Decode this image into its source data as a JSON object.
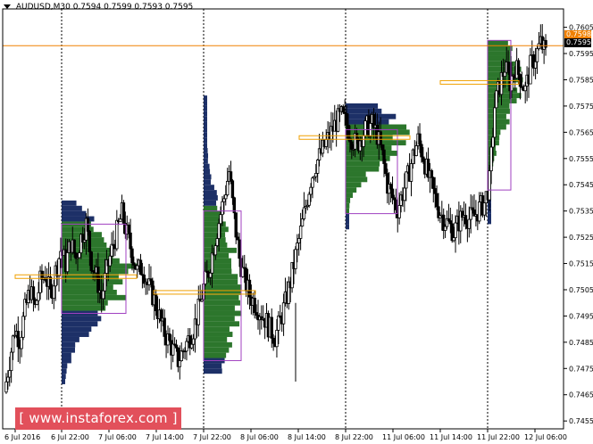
{
  "symbol": {
    "title": "AUDUSD,M30  0.7594 0.7599 0.7593 0.7595"
  },
  "price_tags": {
    "ask": "0.7598",
    "bid": "0.7595"
  },
  "watermark": "[ www.instaforex.com ]",
  "colors": {
    "background": "#ffffff",
    "candle": "#000000",
    "profile_green": "#1a6a1a",
    "profile_navy": "#0a1e5a",
    "value_area_box": "#a040c0",
    "poc_line": "#f0a000",
    "ask_line": "#f08000",
    "bid_tag": "#000000"
  },
  "chart_data": {
    "type": "candlestick",
    "ylim": [
      0.7452,
      0.7612
    ],
    "y_ticks": [
      "0.7605",
      "0.7595",
      "0.7585",
      "0.7575",
      "0.7565",
      "0.7555",
      "0.7545",
      "0.7535",
      "0.7525",
      "0.7515",
      "0.7505",
      "0.7495",
      "0.7485",
      "0.7475",
      "0.7465",
      "0.7455"
    ],
    "x_ticks": [
      "6 Jul 2016",
      "6 Jul 22:00",
      "7 Jul 06:00",
      "7 Jul 14:00",
      "7 Jul 22:00",
      "8 Jul 06:00",
      "8 Jul 14:00",
      "8 Jul 22:00",
      "11 Jul 06:00",
      "11 Jul 14:00",
      "11 Jul 22:00",
      "12 Jul 06:00"
    ],
    "session_separators": [
      "6 Jul 22:00",
      "7 Jul 22:00",
      "8 Jul 22:00",
      "11 Jul 22:00"
    ],
    "ask_level": 0.7598,
    "close_path": [
      0.7466,
      0.7478,
      0.749,
      0.7486,
      0.7497,
      0.7505,
      0.7498,
      0.7508,
      0.7511,
      0.7503,
      0.7512,
      0.752,
      0.7515,
      0.7523,
      0.7517,
      0.7525,
      0.753,
      0.7516,
      0.751,
      0.7502,
      0.7512,
      0.752,
      0.7527,
      0.7534,
      0.7526,
      0.7519,
      0.7512,
      0.7514,
      0.7507,
      0.7503,
      0.7497,
      0.749,
      0.7486,
      0.7482,
      0.7478,
      0.7482,
      0.7486,
      0.749,
      0.7497,
      0.7506,
      0.7512,
      0.7522,
      0.7531,
      0.754,
      0.755,
      0.7532,
      0.7517,
      0.7509,
      0.7503,
      0.75,
      0.7497,
      0.7494,
      0.749,
      0.7487,
      0.7493,
      0.75,
      0.7508,
      0.7518,
      0.7527,
      0.7537,
      0.7547,
      0.7553,
      0.7557,
      0.7561,
      0.7565,
      0.7569,
      0.7571,
      0.7568,
      0.7563,
      0.756,
      0.7564,
      0.7567,
      0.7568,
      0.7564,
      0.7556,
      0.7545,
      0.754,
      0.7536,
      0.7542,
      0.7548,
      0.7556,
      0.7562,
      0.7556,
      0.7548,
      0.7542,
      0.7536,
      0.7532,
      0.753,
      0.7527,
      0.7531,
      0.7534,
      0.7532,
      0.7533,
      0.7536,
      0.7538,
      0.7546,
      0.7575,
      0.7583,
      0.759,
      0.7584,
      0.759,
      0.7586,
      0.7581,
      0.759,
      0.7594,
      0.7599,
      0.7595
    ],
    "sessions": [
      {
        "start": "6 Jul 22:00",
        "poc": 0.751,
        "va_high": 0.753,
        "va_low": 0.7496,
        "low": 0.7469,
        "high": 0.7538
      },
      {
        "start": "7 Jul 22:00",
        "poc": 0.7504,
        "va_high": 0.7535,
        "va_low": 0.7478,
        "low": 0.7473,
        "high": 0.7578
      },
      {
        "start": "8 Jul 22:00",
        "poc": 0.7563,
        "va_high": 0.7566,
        "va_low": 0.7534,
        "low": 0.7528,
        "high": 0.7576
      },
      {
        "start": "11 Jul 22:00",
        "poc": 0.7584,
        "va_high": 0.76,
        "va_low": 0.7543,
        "low": 0.753,
        "high": 0.76
      }
    ]
  }
}
